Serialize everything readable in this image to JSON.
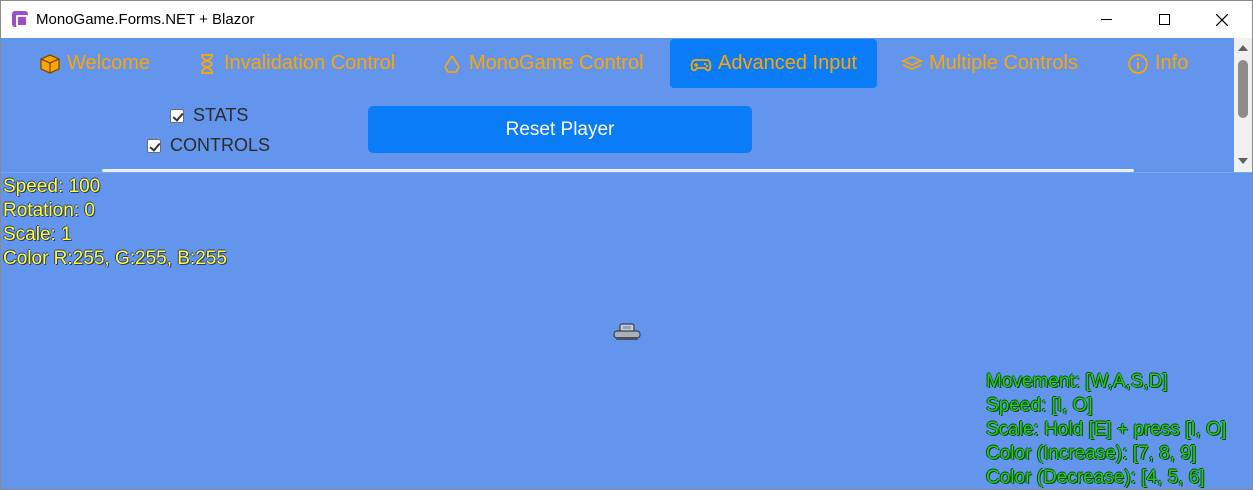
{
  "window": {
    "title": "MonoGame.Forms.NET + Blazor"
  },
  "nav": {
    "tabs": [
      {
        "label": "Welcome",
        "icon": "box-icon",
        "active": false
      },
      {
        "label": "Invalidation Control",
        "icon": "hourglass-icon",
        "active": false
      },
      {
        "label": "MonoGame Control",
        "icon": "recycle-icon",
        "active": false
      },
      {
        "label": "Advanced Input",
        "icon": "gamepad-icon",
        "active": true
      },
      {
        "label": "Multiple Controls",
        "icon": "layers-icon",
        "active": false
      },
      {
        "label": "Info",
        "icon": "info-icon",
        "active": false
      }
    ]
  },
  "options": {
    "stats_label": "STATS",
    "stats_checked": true,
    "controls_label": "CONTROLS",
    "controls_checked": true,
    "reset_label": "Reset Player"
  },
  "game": {
    "stats": [
      "Speed: 100",
      "Rotation: 0",
      "Scale: 1",
      "Color R:255, G:255, B:255"
    ],
    "controls": [
      "Movement: [W,A,S,D]",
      "Speed: [I, O]",
      "Scale: Hold [E] + press [I, O]",
      "Color (Increase): [7, 8, 9]",
      "Color (Decrease): [4, 5, 6]"
    ]
  },
  "colors": {
    "background": "#6495ed",
    "accent": "#0a7cf7",
    "nav_text": "#ffa500",
    "stats_text": "#ffff33",
    "controls_text": "#22cc22"
  }
}
